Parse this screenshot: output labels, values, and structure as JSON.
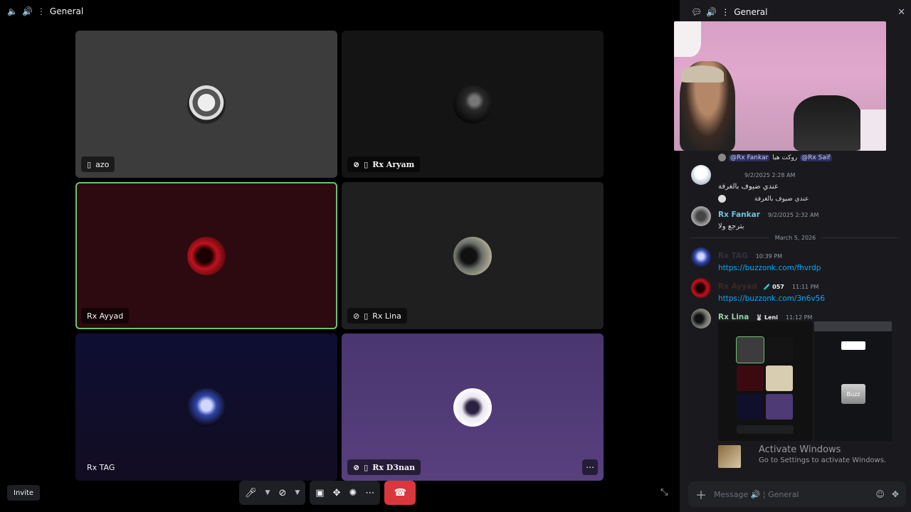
{
  "stage": {
    "channel_name": "General",
    "invite_label": "Invite"
  },
  "tiles": [
    {
      "name": "azo",
      "bg": "#3c3c3c"
    },
    {
      "name": "Rx Aryam",
      "bg": "#141414"
    },
    {
      "name": "Rx Ayyad",
      "bg": "#2d0a10",
      "speaking": true
    },
    {
      "name": "Rx Lina",
      "bg": "#1f1f1f"
    },
    {
      "name": "Rx TAG",
      "bg": "#10102a"
    },
    {
      "name": "Rx D3nan",
      "bg": "#4e3a74"
    }
  ],
  "panel": {
    "channel_name": "General",
    "messages": {
      "m1": {
        "reply_to": "@Rx Fankar",
        "reply_text": "روكت هيا",
        "reply_mention2": "@Rx Saif",
        "time": "9/2/2025 2:28 AM",
        "text": "عندي ضيوف بالغرفة"
      },
      "m2": {
        "reply_text": "عندي ضيوف بالغرفة",
        "username": "Rx Fankar",
        "time": "9/2/2025 2:32 AM",
        "text": "بترجع ولا"
      },
      "date_divider": "March 5, 2026",
      "m3": {
        "username": "Rx TAG",
        "time": "10:39 PM",
        "link": "https://buzzonk.com/fhvrdp"
      },
      "m4": {
        "username": "Rx Ayyad",
        "tag": "057",
        "time": "11:11 PM",
        "link": "https://buzzonk.com/3n6v56"
      },
      "m5": {
        "username": "Rx Lina",
        "tag": "Leni",
        "time": "11:12 PM",
        "attachment_button": "Buzz"
      }
    },
    "watermark": {
      "title": "Activate Windows",
      "subtitle": "Go to Settings to activate Windows."
    },
    "composer": {
      "placeholder_prefix": "Message",
      "placeholder_channel": "General"
    }
  },
  "colors": {
    "accent_link": "#00a8fc",
    "end_call": "#da373c",
    "speaking_outline": "#6fbf73",
    "fankar_name": "#6fc2e0",
    "lina_name": "#8fd1a5"
  }
}
